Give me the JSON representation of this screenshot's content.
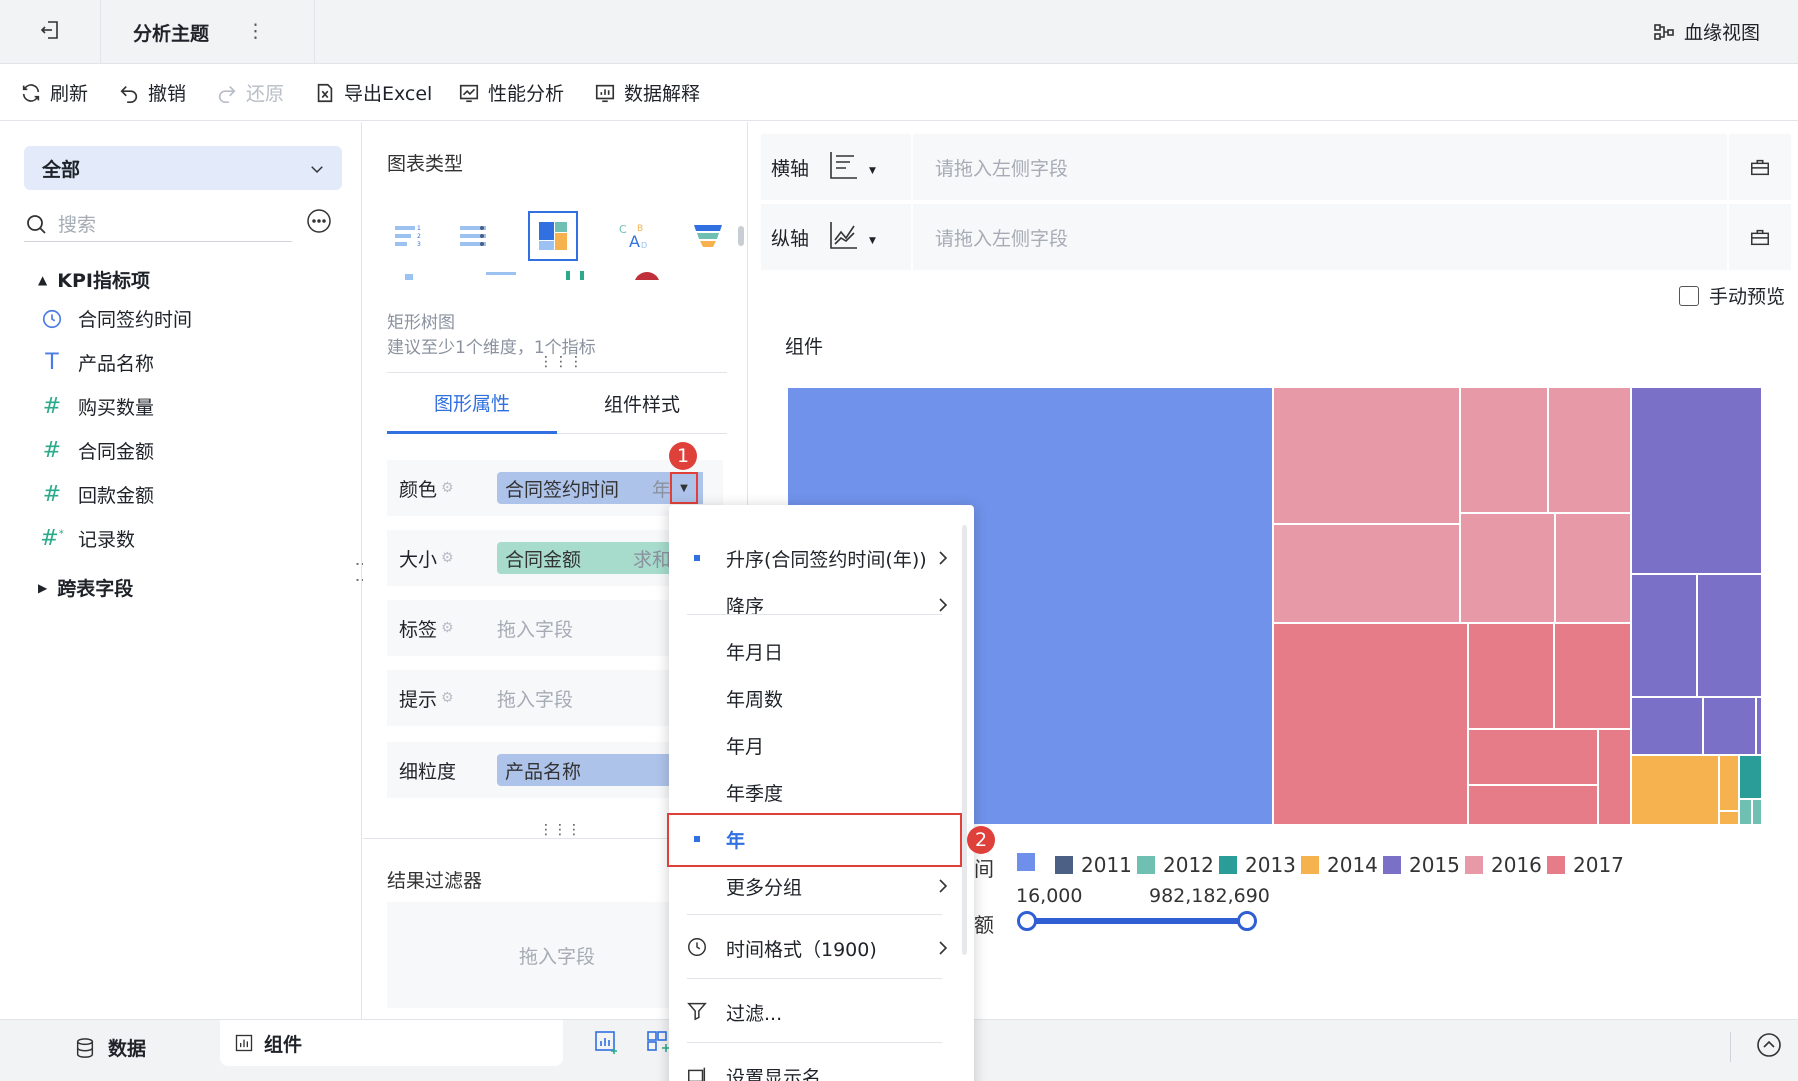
{
  "topbar": {
    "title": "分析主题",
    "more_icon": "more-vertical-icon",
    "lineage_label": "血缘视图"
  },
  "toolbar": {
    "refresh": "刷新",
    "undo": "撤销",
    "redo": "还原",
    "export_excel": "导出Excel",
    "perf": "性能分析",
    "explain": "数据解释"
  },
  "left": {
    "scope": "全部",
    "search_placeholder": "搜索",
    "group1": "KPI指标项",
    "fields": [
      {
        "label": "合同签约时间",
        "icon": "clock-icon"
      },
      {
        "label": "产品名称",
        "icon": "text-type-icon"
      },
      {
        "label": "购买数量",
        "icon": "hash-icon"
      },
      {
        "label": "合同金额",
        "icon": "hash-icon"
      },
      {
        "label": "回款金额",
        "icon": "hash-icon"
      },
      {
        "label": "记录数",
        "icon": "hash-star-icon"
      }
    ],
    "group2": "跨表字段"
  },
  "mid": {
    "chart_type_title": "图表类型",
    "chart_name": "矩形树图",
    "chart_hint": "建议至少1个维度，1个指标",
    "tab_graphic": "图形属性",
    "tab_style": "组件样式",
    "props": [
      {
        "label": "颜色",
        "value": "合同签约时间",
        "suffix": "年"
      },
      {
        "label": "大小",
        "value": "合同金额",
        "suffix": "求和"
      },
      {
        "label": "标签",
        "value": "拖入字段"
      },
      {
        "label": "提示",
        "value": "拖入字段"
      },
      {
        "label": "细粒度",
        "value": "产品名称"
      }
    ],
    "filter_title": "结果过滤器",
    "filter_placeholder": "拖入字段"
  },
  "right": {
    "x_axis_label": "横轴",
    "y_axis_label": "纵轴",
    "axis_placeholder": "请拖入左侧字段",
    "manual_preview": "手动预览",
    "component_title": "组件",
    "legend_partial_1": "间",
    "legend_partial_2": "额",
    "size_min": "16,000",
    "size_max": "982,182,690"
  },
  "menu": {
    "items": [
      "升序(合同签约时间(年))",
      "降序",
      "年月日",
      "年周数",
      "年月",
      "年季度",
      "年",
      "更多分组",
      "时间格式（1900)",
      "过滤...",
      "设置显示名"
    ]
  },
  "badges": [
    "1",
    "2"
  ],
  "bottom": {
    "tab_data": "数据",
    "tab_component": "组件"
  },
  "colors": {
    "accent": "#3070e0",
    "selected_border": "#e0403a"
  },
  "chart_data": {
    "type": "treemap",
    "legend": [
      {
        "label": "",
        "color": "#6e8fea"
      },
      {
        "label": "2011",
        "color": "#4c5f85"
      },
      {
        "label": "2012",
        "color": "#6fc0b2"
      },
      {
        "label": "2013",
        "color": "#2a9d98"
      },
      {
        "label": "2014",
        "color": "#f5b24e"
      },
      {
        "label": "2015",
        "color": "#7b70c8"
      },
      {
        "label": "2016",
        "color": "#e899a8"
      },
      {
        "label": "2017",
        "color": "#e67c87"
      }
    ]
  }
}
